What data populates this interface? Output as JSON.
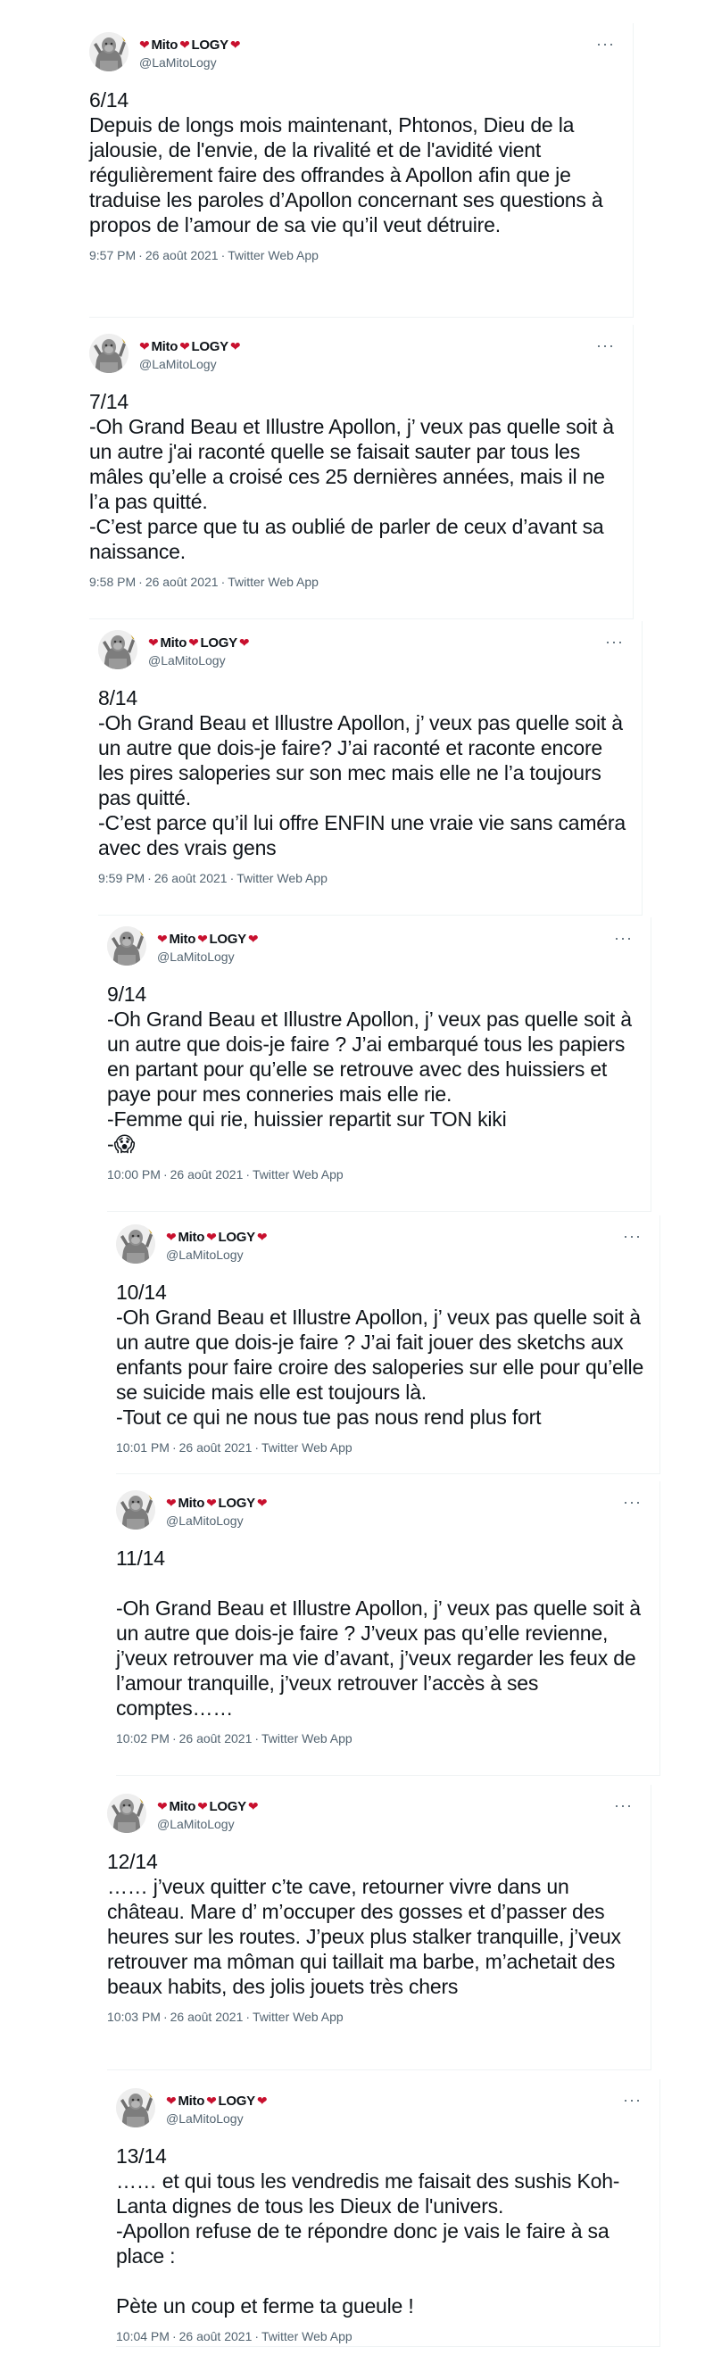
{
  "tweets": [
    {
      "author": "Mito",
      "author_b": "LOGY",
      "handle": "@LaMitoLogy",
      "text": "6/14\nDepuis de longs mois maintenant, Phtonos, Dieu de la jalousie, de l'envie, de la rivalité et de l'avidité vient régulièrement faire des offrandes à Apollon afin que je traduise les paroles d’Apollon concernant ses questions à propos de l’amour de sa vie qu’il veut détruire.",
      "time": "9:57 PM",
      "date": "26 août 2021",
      "source": "Twitter Web App"
    },
    {
      "author": "Mito",
      "author_b": "LOGY",
      "handle": "@LaMitoLogy",
      "text": "7/14\n-Oh Grand Beau et Illustre Apollon, j’ veux pas quelle soit à un autre j'ai raconté quelle se faisait sauter par tous les mâles qu’elle a croisé ces 25 dernières années, mais il ne l’a pas quitté.\n-C’est parce que tu as oublié de parler de ceux d’avant sa naissance.",
      "time": "9:58 PM",
      "date": "26 août 2021",
      "source": "Twitter Web App"
    },
    {
      "author": "Mito",
      "author_b": "LOGY",
      "handle": "@LaMitoLogy",
      "text": "8/14\n-Oh Grand Beau et Illustre Apollon, j’ veux pas quelle soit à un autre que dois-je faire? J’ai raconté et raconte encore les pires saloperies sur son mec mais elle ne l’a toujours pas quitté.\n-C’est parce qu’il lui offre ENFIN une vraie vie sans caméra avec des vrais gens",
      "time": "9:59 PM",
      "date": "26 août 2021",
      "source": "Twitter Web App"
    },
    {
      "author": "Mito",
      "author_b": "LOGY",
      "handle": "@LaMitoLogy",
      "text": "9/14\n-Oh Grand Beau et Illustre Apollon, j’ veux pas quelle soit à un autre que dois-je faire ? J’ai embarqué tous les papiers en partant pour qu’elle se retrouve avec des huissiers et paye pour mes conneries mais elle rie.\n-Femme qui rie, huissier repartit sur TON kiki\n-😱",
      "time": "10:00 PM",
      "date": "26 août 2021",
      "source": "Twitter Web App"
    },
    {
      "author": "Mito",
      "author_b": "LOGY",
      "handle": "@LaMitoLogy",
      "text": "10/14\n-Oh Grand Beau et Illustre Apollon, j’ veux pas quelle soit à un autre que dois-je faire ? J’ai fait jouer des sketchs aux enfants pour faire croire des saloperies sur elle pour qu’elle se suicide mais elle est toujours là.\n-Tout ce qui ne nous tue pas nous rend plus fort",
      "time": "10:01 PM",
      "date": "26 août 2021",
      "source": "Twitter Web App"
    },
    {
      "author": "Mito",
      "author_b": "LOGY",
      "handle": "@LaMitoLogy",
      "text": "11/14\n\n-Oh Grand Beau et Illustre Apollon, j’ veux pas quelle soit à un autre que dois-je faire ? J’veux pas qu’elle revienne, j’veux retrouver ma vie d’avant, j’veux regarder les feux de l’amour tranquille, j’veux retrouver l’accès à ses comptes……",
      "time": "10:02 PM",
      "date": "26 août 2021",
      "source": "Twitter Web App"
    },
    {
      "author": "Mito",
      "author_b": "LOGY",
      "handle": "@LaMitoLogy",
      "text": "12/14\n…… j’veux quitter c’te cave, retourner vivre dans un château. Mare d’ m’occuper des gosses et d’passer des heures sur les routes. J’peux plus stalker tranquille, j’veux retrouver ma môman qui taillait ma barbe, m’achetait des beaux habits, des jolis jouets très chers",
      "time": "10:03 PM",
      "date": "26 août 2021",
      "source": "Twitter Web App"
    },
    {
      "author": "Mito",
      "author_b": "LOGY",
      "handle": "@LaMitoLogy",
      "text": "13/14\n…… et qui tous les vendredis me faisait des sushis Koh-Lanta dignes de tous les Dieux de l'univers.\n-Apollon refuse de te répondre donc je vais le faire à sa place :\n\nPète un coup et ferme ta gueule !",
      "time": "10:04 PM",
      "date": "26 août 2021",
      "source": "Twitter Web App"
    }
  ],
  "colors": {
    "heart": "#c8102e",
    "muted": "#536471",
    "text": "#0f1419"
  },
  "icons": {
    "more": "more-dots-icon",
    "heart": "heart-icon",
    "avatar": "ape-statue-avatar"
  }
}
